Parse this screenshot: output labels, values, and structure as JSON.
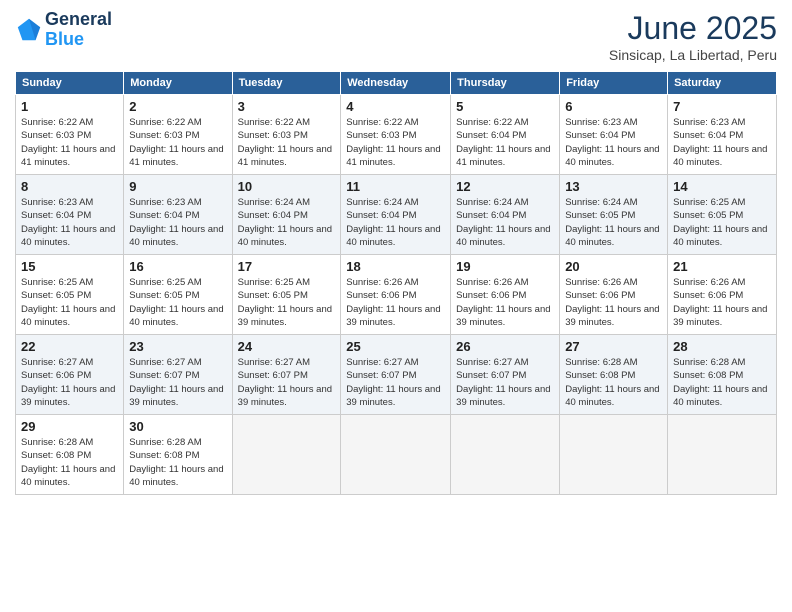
{
  "logo": {
    "line1": "General",
    "line2": "Blue"
  },
  "title": "June 2025",
  "location": "Sinsicap, La Libertad, Peru",
  "weekdays": [
    "Sunday",
    "Monday",
    "Tuesday",
    "Wednesday",
    "Thursday",
    "Friday",
    "Saturday"
  ],
  "weeks": [
    [
      {
        "day": "1",
        "sunrise": "6:22 AM",
        "sunset": "6:03 PM",
        "daylight": "11 hours and 41 minutes."
      },
      {
        "day": "2",
        "sunrise": "6:22 AM",
        "sunset": "6:03 PM",
        "daylight": "11 hours and 41 minutes."
      },
      {
        "day": "3",
        "sunrise": "6:22 AM",
        "sunset": "6:03 PM",
        "daylight": "11 hours and 41 minutes."
      },
      {
        "day": "4",
        "sunrise": "6:22 AM",
        "sunset": "6:03 PM",
        "daylight": "11 hours and 41 minutes."
      },
      {
        "day": "5",
        "sunrise": "6:22 AM",
        "sunset": "6:04 PM",
        "daylight": "11 hours and 41 minutes."
      },
      {
        "day": "6",
        "sunrise": "6:23 AM",
        "sunset": "6:04 PM",
        "daylight": "11 hours and 40 minutes."
      },
      {
        "day": "7",
        "sunrise": "6:23 AM",
        "sunset": "6:04 PM",
        "daylight": "11 hours and 40 minutes."
      }
    ],
    [
      {
        "day": "8",
        "sunrise": "6:23 AM",
        "sunset": "6:04 PM",
        "daylight": "11 hours and 40 minutes."
      },
      {
        "day": "9",
        "sunrise": "6:23 AM",
        "sunset": "6:04 PM",
        "daylight": "11 hours and 40 minutes."
      },
      {
        "day": "10",
        "sunrise": "6:24 AM",
        "sunset": "6:04 PM",
        "daylight": "11 hours and 40 minutes."
      },
      {
        "day": "11",
        "sunrise": "6:24 AM",
        "sunset": "6:04 PM",
        "daylight": "11 hours and 40 minutes."
      },
      {
        "day": "12",
        "sunrise": "6:24 AM",
        "sunset": "6:04 PM",
        "daylight": "11 hours and 40 minutes."
      },
      {
        "day": "13",
        "sunrise": "6:24 AM",
        "sunset": "6:05 PM",
        "daylight": "11 hours and 40 minutes."
      },
      {
        "day": "14",
        "sunrise": "6:25 AM",
        "sunset": "6:05 PM",
        "daylight": "11 hours and 40 minutes."
      }
    ],
    [
      {
        "day": "15",
        "sunrise": "6:25 AM",
        "sunset": "6:05 PM",
        "daylight": "11 hours and 40 minutes."
      },
      {
        "day": "16",
        "sunrise": "6:25 AM",
        "sunset": "6:05 PM",
        "daylight": "11 hours and 40 minutes."
      },
      {
        "day": "17",
        "sunrise": "6:25 AM",
        "sunset": "6:05 PM",
        "daylight": "11 hours and 39 minutes."
      },
      {
        "day": "18",
        "sunrise": "6:26 AM",
        "sunset": "6:06 PM",
        "daylight": "11 hours and 39 minutes."
      },
      {
        "day": "19",
        "sunrise": "6:26 AM",
        "sunset": "6:06 PM",
        "daylight": "11 hours and 39 minutes."
      },
      {
        "day": "20",
        "sunrise": "6:26 AM",
        "sunset": "6:06 PM",
        "daylight": "11 hours and 39 minutes."
      },
      {
        "day": "21",
        "sunrise": "6:26 AM",
        "sunset": "6:06 PM",
        "daylight": "11 hours and 39 minutes."
      }
    ],
    [
      {
        "day": "22",
        "sunrise": "6:27 AM",
        "sunset": "6:06 PM",
        "daylight": "11 hours and 39 minutes."
      },
      {
        "day": "23",
        "sunrise": "6:27 AM",
        "sunset": "6:07 PM",
        "daylight": "11 hours and 39 minutes."
      },
      {
        "day": "24",
        "sunrise": "6:27 AM",
        "sunset": "6:07 PM",
        "daylight": "11 hours and 39 minutes."
      },
      {
        "day": "25",
        "sunrise": "6:27 AM",
        "sunset": "6:07 PM",
        "daylight": "11 hours and 39 minutes."
      },
      {
        "day": "26",
        "sunrise": "6:27 AM",
        "sunset": "6:07 PM",
        "daylight": "11 hours and 39 minutes."
      },
      {
        "day": "27",
        "sunrise": "6:28 AM",
        "sunset": "6:08 PM",
        "daylight": "11 hours and 40 minutes."
      },
      {
        "day": "28",
        "sunrise": "6:28 AM",
        "sunset": "6:08 PM",
        "daylight": "11 hours and 40 minutes."
      }
    ],
    [
      {
        "day": "29",
        "sunrise": "6:28 AM",
        "sunset": "6:08 PM",
        "daylight": "11 hours and 40 minutes."
      },
      {
        "day": "30",
        "sunrise": "6:28 AM",
        "sunset": "6:08 PM",
        "daylight": "11 hours and 40 minutes."
      },
      null,
      null,
      null,
      null,
      null
    ]
  ]
}
